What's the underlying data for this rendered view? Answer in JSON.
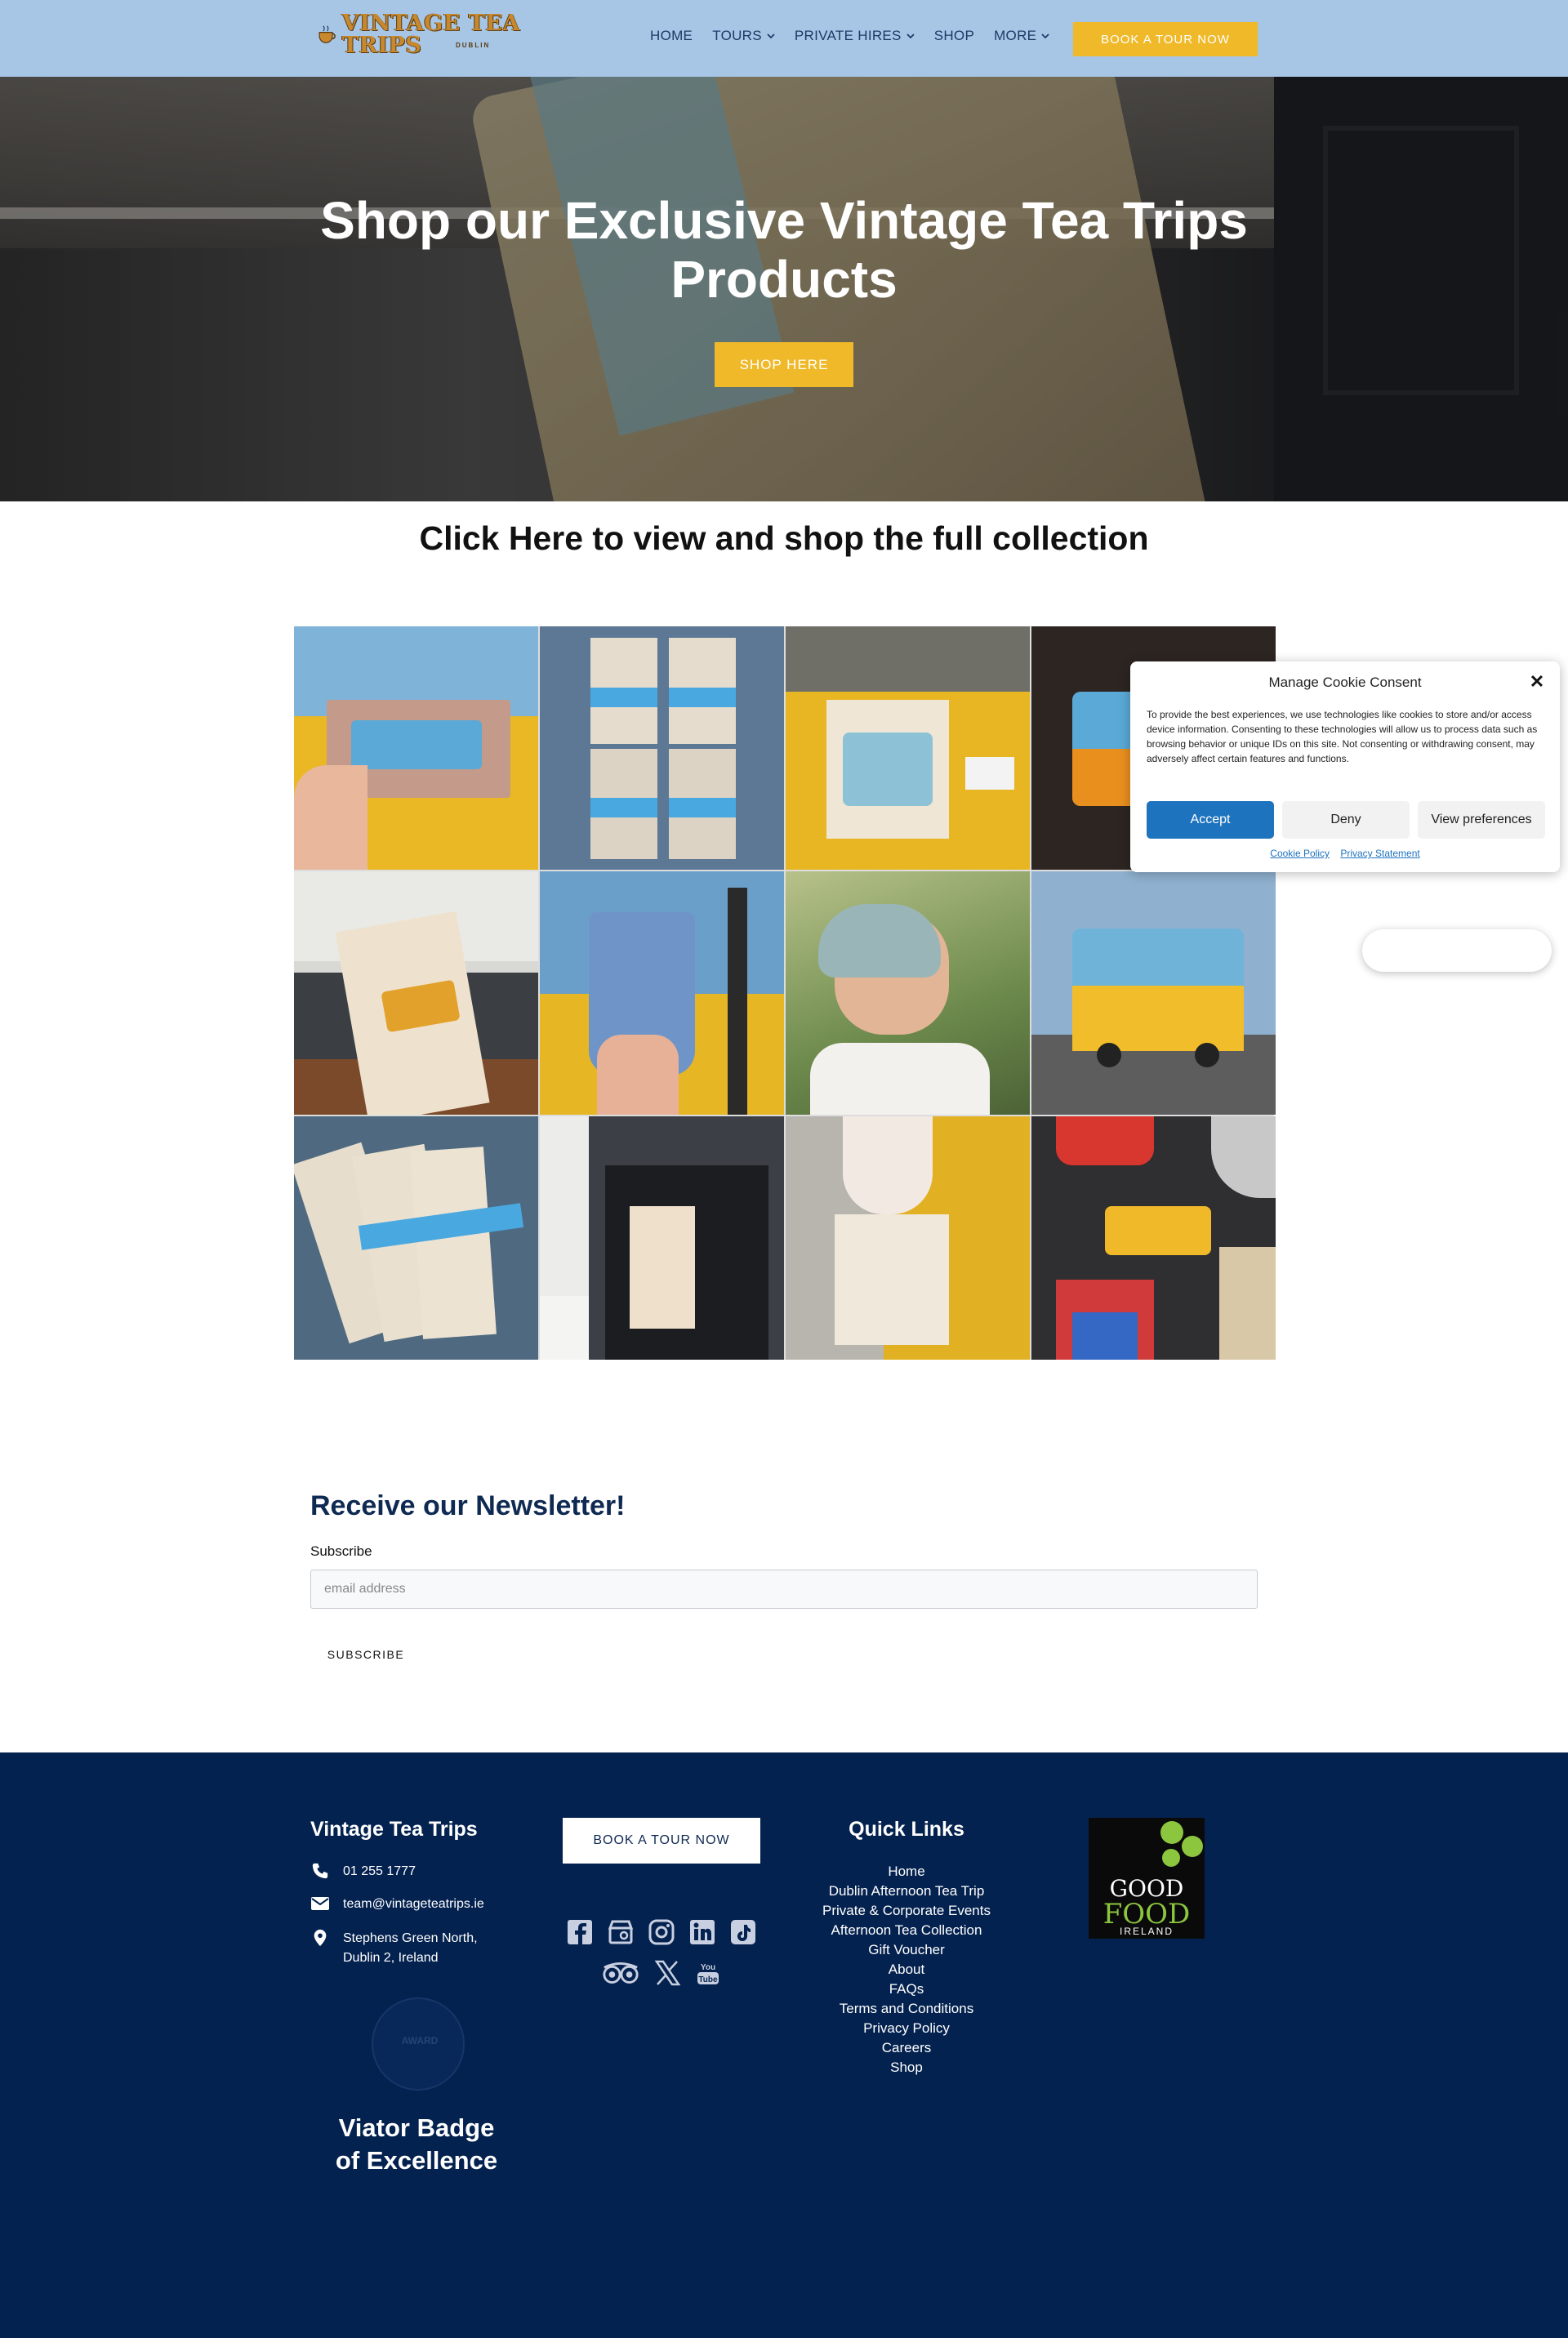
{
  "header": {
    "logo_text": "VINTAGE TEA TRIPS",
    "logo_sub": "DUBLIN",
    "nav": [
      {
        "label": "HOME",
        "dropdown": false
      },
      {
        "label": "TOURS",
        "dropdown": true
      },
      {
        "label": "PRIVATE HIRES",
        "dropdown": true
      },
      {
        "label": "SHOP",
        "dropdown": false
      },
      {
        "label": "MORE",
        "dropdown": true
      }
    ],
    "book_label": "BOOK A TOUR NOW"
  },
  "hero": {
    "title": "Shop our Exclusive Vintage Tea Trips Products",
    "button_label": "SHOP HERE"
  },
  "collection": {
    "title": "Click Here to view and shop the full collection"
  },
  "newsletter": {
    "title": "Receive our Newsletter!",
    "label": "Subscribe",
    "placeholder": "email address",
    "button_label": "SUBSCRIBE"
  },
  "footer": {
    "brand": "Vintage Tea Trips",
    "phone": "01 255 1777",
    "email": "team@vintageteatrips.ie",
    "address_line1": "Stephens Green North,",
    "address_line2": "Dublin 2, Ireland",
    "viator_line1": "Viator Badge",
    "viator_line2": "of Excellence",
    "book_label": "BOOK A TOUR NOW",
    "quick_links_title": "Quick Links",
    "quick_links": [
      "Home",
      "Dublin Afternoon Tea Trip",
      "Private & Corporate Events",
      "Afternoon Tea Collection",
      "Gift Voucher",
      "About",
      "FAQs",
      "Terms and Conditions",
      "Privacy Policy",
      "Careers",
      "Shop"
    ],
    "good_food": {
      "line1": "GOOD",
      "line2": "FOOD",
      "line3": "IRELAND"
    },
    "socials": [
      "facebook-icon",
      "google-business-icon",
      "instagram-icon",
      "linkedin-icon",
      "tiktok-icon",
      "tripadvisor-icon",
      "x-twitter-icon",
      "youtube-icon"
    ]
  },
  "cookie": {
    "title": "Manage Cookie Consent",
    "text": "To provide the best experiences, we use technologies like cookies to store and/or access device information. Consenting to these technologies will allow us to process data such as browsing behavior or unique IDs on this site. Not consenting or withdrawing consent, may adversely affect certain features and functions.",
    "accept": "Accept",
    "deny": "Deny",
    "preferences": "View preferences",
    "cookie_policy": "Cookie Policy",
    "privacy_statement": "Privacy Statement"
  },
  "colors": {
    "header_bg": "#a7c6e6",
    "accent_yellow": "#efb92a",
    "navy": "#04224f",
    "cookie_blue": "#1e73be"
  }
}
